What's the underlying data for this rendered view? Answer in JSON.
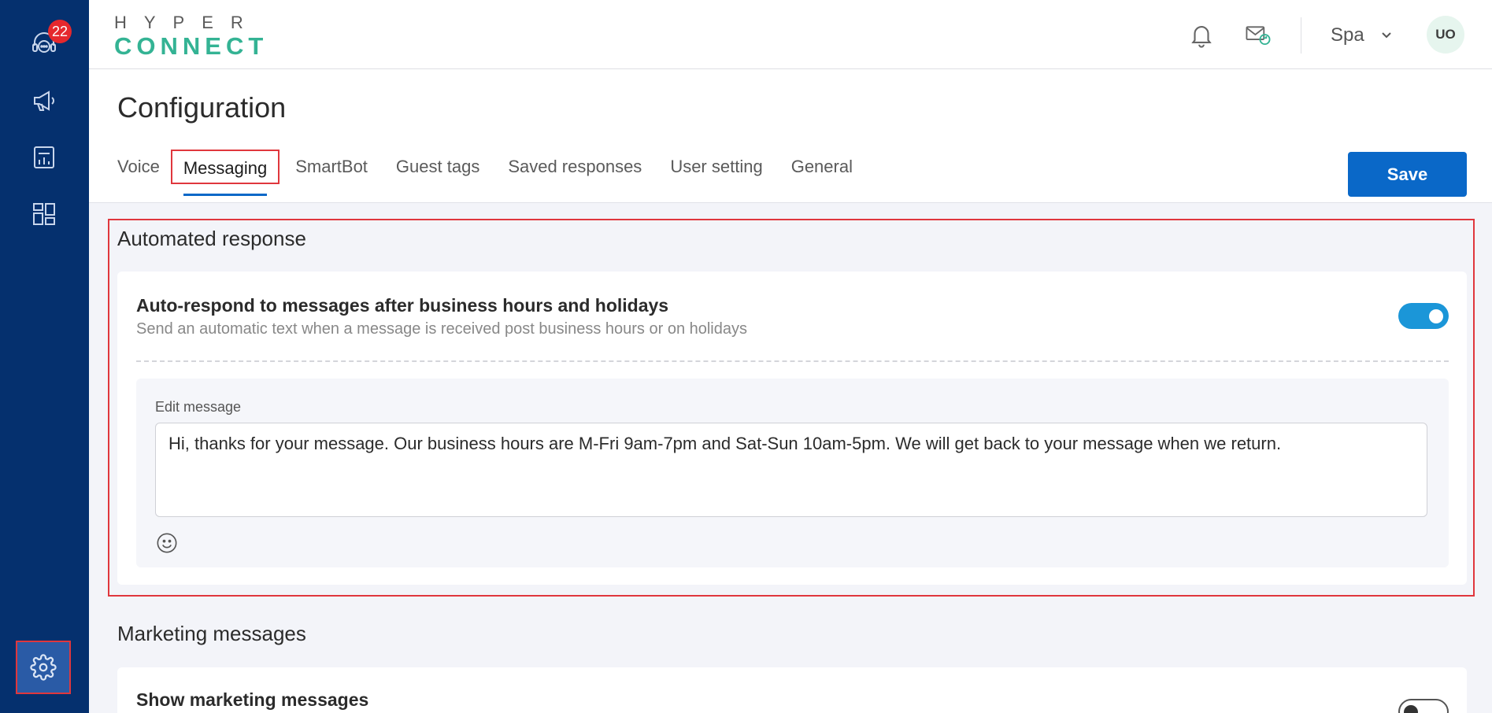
{
  "sidebar": {
    "badge_count": "22",
    "icons": [
      "support-agent-icon",
      "megaphone-icon",
      "report-icon",
      "dashboard-icon",
      "gear-icon"
    ]
  },
  "header": {
    "logo_top": "HYPER",
    "logo_bottom": "CONNECT",
    "location": "Spa",
    "avatar_initials": "UO"
  },
  "page": {
    "title": "Configuration",
    "save_label": "Save",
    "tabs": [
      {
        "label": "Voice"
      },
      {
        "label": "Messaging"
      },
      {
        "label": "SmartBot"
      },
      {
        "label": "Guest tags"
      },
      {
        "label": "Saved responses"
      },
      {
        "label": "User setting"
      },
      {
        "label": "General"
      }
    ]
  },
  "automated_response": {
    "title": "Automated response",
    "card_title": "Auto-respond to messages after business hours and holidays",
    "card_subtitle": "Send an automatic text when a message is received post business hours or on holidays",
    "toggle_on": true,
    "edit_label": "Edit message",
    "message": "Hi, thanks for your message. Our business hours are M-Fri 9am-7pm and Sat-Sun 10am-5pm. We will get back to your message when we return."
  },
  "marketing": {
    "title": "Marketing messages",
    "card_title": "Show marketing messages",
    "toggle_on": false
  },
  "colors": {
    "sidebar_bg": "#05306e",
    "accent_blue": "#0a68c8",
    "toggle_on": "#1b96d8",
    "highlight_red": "#e0373d",
    "logo_green": "#34b394"
  }
}
